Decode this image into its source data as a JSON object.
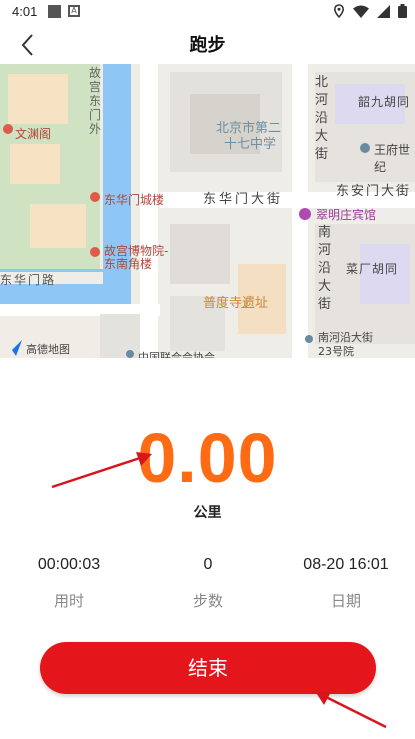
{
  "status_bar": {
    "time": "4:01"
  },
  "nav": {
    "title": "跑步"
  },
  "map": {
    "labels": {
      "gugong_dongmenwai": "故宫东门外",
      "wenyuange": "文渊阁",
      "donghuamen_chenglou": "东华门城楼",
      "bowuyuan_1": "故宫博物院-",
      "bowuyuan_2": "东南角楼",
      "donghuamen_lu": "东华门路",
      "amap": "高德地图",
      "zhongxue_1": "北京市第二",
      "zhongxue_2": "十七中学",
      "donghuamen_dajie": "东华门大街",
      "bei_heyan_dajie": "北河沿大街",
      "dong_anmen_dajie": "东安门大街",
      "cuimingzhuang": "翠明庄宾馆",
      "nan_heyan_dajie": "南河沿大街",
      "puduси": "普度寺遗址",
      "caichang_hutong": "菜厂胡同",
      "shaojiu_hutong": "韶九胡同",
      "wangfu": "王府世纪",
      "nanheyan_23_1": "南河沿大街",
      "nanheyan_23_2": "23号院",
      "lianhehui": "中国联合会协会"
    }
  },
  "run": {
    "distance": "0.00",
    "unit": "公里",
    "stats": [
      {
        "value": "00:00:03",
        "label": "用时"
      },
      {
        "value": "0",
        "label": "步数"
      },
      {
        "value": "08-20 16:01",
        "label": "日期"
      }
    ],
    "end_label": "结束"
  },
  "colors": {
    "accent": "#ff6a15",
    "button": "#e5161b"
  }
}
